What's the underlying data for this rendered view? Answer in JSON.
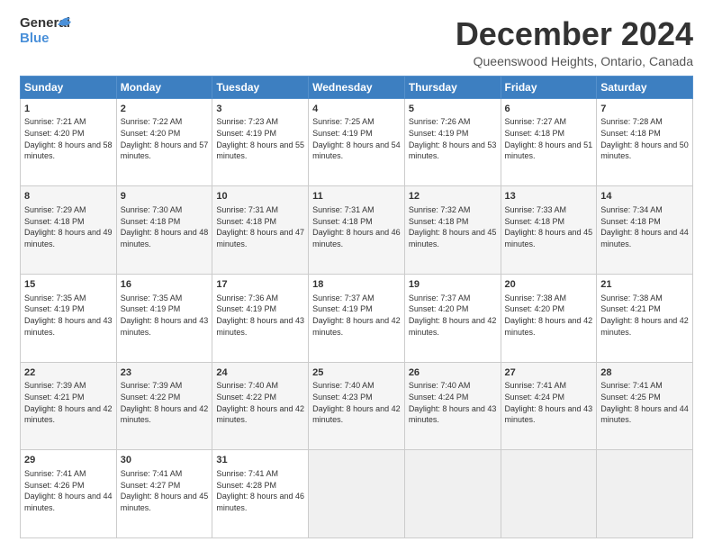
{
  "header": {
    "logo_line1": "General",
    "logo_line2": "Blue",
    "month_title": "December 2024",
    "location": "Queenswood Heights, Ontario, Canada"
  },
  "weekdays": [
    "Sunday",
    "Monday",
    "Tuesday",
    "Wednesday",
    "Thursday",
    "Friday",
    "Saturday"
  ],
  "weeks": [
    [
      {
        "day": "1",
        "sunrise": "7:21 AM",
        "sunset": "4:20 PM",
        "daylight": "8 hours and 58 minutes."
      },
      {
        "day": "2",
        "sunrise": "7:22 AM",
        "sunset": "4:20 PM",
        "daylight": "8 hours and 57 minutes."
      },
      {
        "day": "3",
        "sunrise": "7:23 AM",
        "sunset": "4:19 PM",
        "daylight": "8 hours and 55 minutes."
      },
      {
        "day": "4",
        "sunrise": "7:25 AM",
        "sunset": "4:19 PM",
        "daylight": "8 hours and 54 minutes."
      },
      {
        "day": "5",
        "sunrise": "7:26 AM",
        "sunset": "4:19 PM",
        "daylight": "8 hours and 53 minutes."
      },
      {
        "day": "6",
        "sunrise": "7:27 AM",
        "sunset": "4:18 PM",
        "daylight": "8 hours and 51 minutes."
      },
      {
        "day": "7",
        "sunrise": "7:28 AM",
        "sunset": "4:18 PM",
        "daylight": "8 hours and 50 minutes."
      }
    ],
    [
      {
        "day": "8",
        "sunrise": "7:29 AM",
        "sunset": "4:18 PM",
        "daylight": "8 hours and 49 minutes."
      },
      {
        "day": "9",
        "sunrise": "7:30 AM",
        "sunset": "4:18 PM",
        "daylight": "8 hours and 48 minutes."
      },
      {
        "day": "10",
        "sunrise": "7:31 AM",
        "sunset": "4:18 PM",
        "daylight": "8 hours and 47 minutes."
      },
      {
        "day": "11",
        "sunrise": "7:31 AM",
        "sunset": "4:18 PM",
        "daylight": "8 hours and 46 minutes."
      },
      {
        "day": "12",
        "sunrise": "7:32 AM",
        "sunset": "4:18 PM",
        "daylight": "8 hours and 45 minutes."
      },
      {
        "day": "13",
        "sunrise": "7:33 AM",
        "sunset": "4:18 PM",
        "daylight": "8 hours and 45 minutes."
      },
      {
        "day": "14",
        "sunrise": "7:34 AM",
        "sunset": "4:18 PM",
        "daylight": "8 hours and 44 minutes."
      }
    ],
    [
      {
        "day": "15",
        "sunrise": "7:35 AM",
        "sunset": "4:19 PM",
        "daylight": "8 hours and 43 minutes."
      },
      {
        "day": "16",
        "sunrise": "7:35 AM",
        "sunset": "4:19 PM",
        "daylight": "8 hours and 43 minutes."
      },
      {
        "day": "17",
        "sunrise": "7:36 AM",
        "sunset": "4:19 PM",
        "daylight": "8 hours and 43 minutes."
      },
      {
        "day": "18",
        "sunrise": "7:37 AM",
        "sunset": "4:19 PM",
        "daylight": "8 hours and 42 minutes."
      },
      {
        "day": "19",
        "sunrise": "7:37 AM",
        "sunset": "4:20 PM",
        "daylight": "8 hours and 42 minutes."
      },
      {
        "day": "20",
        "sunrise": "7:38 AM",
        "sunset": "4:20 PM",
        "daylight": "8 hours and 42 minutes."
      },
      {
        "day": "21",
        "sunrise": "7:38 AM",
        "sunset": "4:21 PM",
        "daylight": "8 hours and 42 minutes."
      }
    ],
    [
      {
        "day": "22",
        "sunrise": "7:39 AM",
        "sunset": "4:21 PM",
        "daylight": "8 hours and 42 minutes."
      },
      {
        "day": "23",
        "sunrise": "7:39 AM",
        "sunset": "4:22 PM",
        "daylight": "8 hours and 42 minutes."
      },
      {
        "day": "24",
        "sunrise": "7:40 AM",
        "sunset": "4:22 PM",
        "daylight": "8 hours and 42 minutes."
      },
      {
        "day": "25",
        "sunrise": "7:40 AM",
        "sunset": "4:23 PM",
        "daylight": "8 hours and 42 minutes."
      },
      {
        "day": "26",
        "sunrise": "7:40 AM",
        "sunset": "4:24 PM",
        "daylight": "8 hours and 43 minutes."
      },
      {
        "day": "27",
        "sunrise": "7:41 AM",
        "sunset": "4:24 PM",
        "daylight": "8 hours and 43 minutes."
      },
      {
        "day": "28",
        "sunrise": "7:41 AM",
        "sunset": "4:25 PM",
        "daylight": "8 hours and 44 minutes."
      }
    ],
    [
      {
        "day": "29",
        "sunrise": "7:41 AM",
        "sunset": "4:26 PM",
        "daylight": "8 hours and 44 minutes."
      },
      {
        "day": "30",
        "sunrise": "7:41 AM",
        "sunset": "4:27 PM",
        "daylight": "8 hours and 45 minutes."
      },
      {
        "day": "31",
        "sunrise": "7:41 AM",
        "sunset": "4:28 PM",
        "daylight": "8 hours and 46 minutes."
      },
      null,
      null,
      null,
      null
    ]
  ],
  "labels": {
    "sunrise": "Sunrise:",
    "sunset": "Sunset:",
    "daylight": "Daylight:"
  }
}
